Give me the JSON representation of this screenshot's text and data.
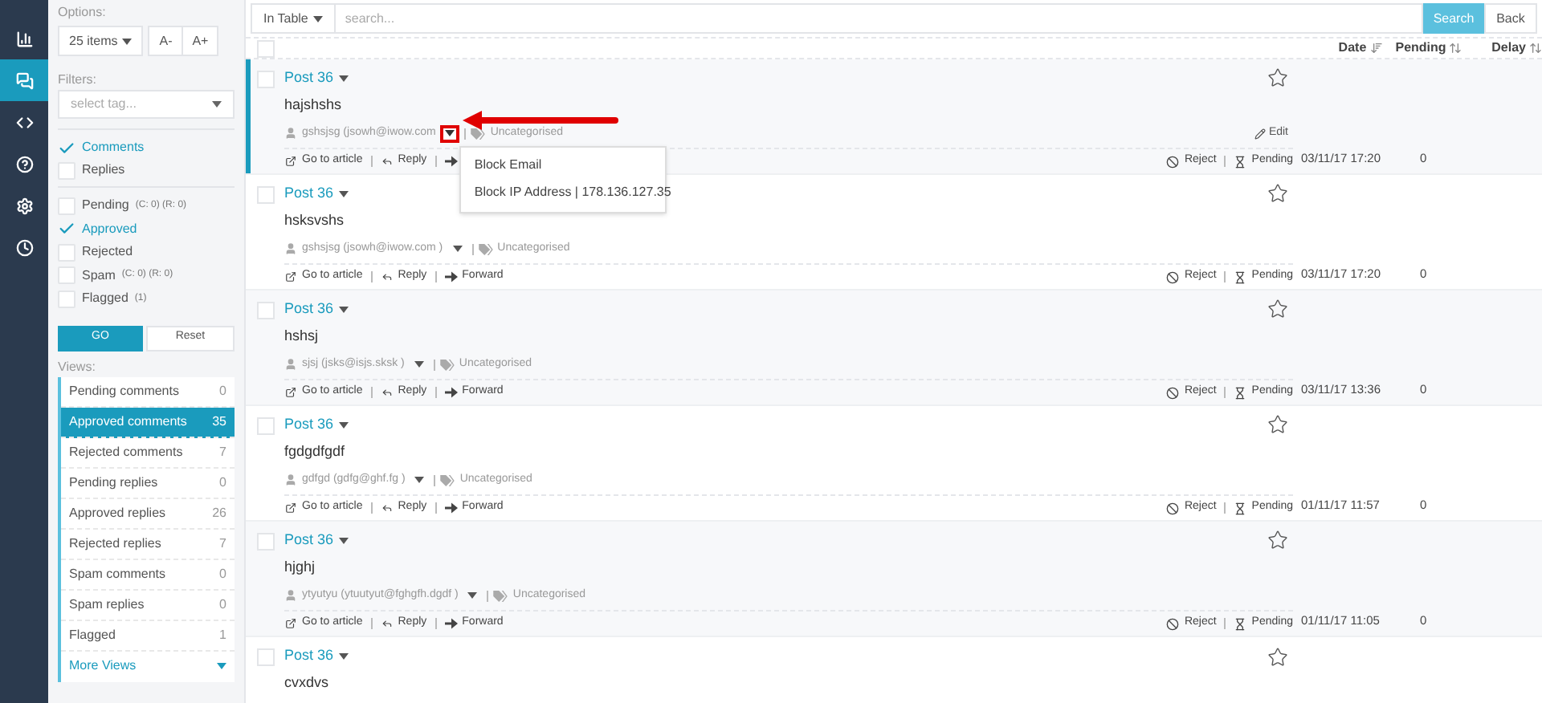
{
  "nav": [
    {
      "kind": "chart",
      "selected": false
    },
    {
      "kind": "comments",
      "selected": true
    },
    {
      "kind": "code",
      "selected": false
    },
    {
      "kind": "help",
      "selected": false
    },
    {
      "kind": "settings",
      "selected": false
    },
    {
      "kind": "history",
      "selected": false
    }
  ],
  "sidebar": {
    "options_label": "Options:",
    "page_size": "25 items",
    "font_smaller": "A-",
    "font_larger": "A+",
    "filters_label": "Filters:",
    "tag_placeholder": "select tag...",
    "types": [
      {
        "label": "Comments",
        "checked": true
      },
      {
        "label": "Replies",
        "checked": false
      }
    ],
    "statuses": [
      {
        "label": "Pending",
        "counts": "(C: 0) (R: 0)",
        "checked": false
      },
      {
        "label": "Approved",
        "checked": true
      },
      {
        "label": "Rejected",
        "checked": false
      },
      {
        "label": "Spam",
        "counts": "(C: 0) (R: 0)",
        "checked": false
      },
      {
        "label": "Flagged",
        "counts": "(1)",
        "checked": false
      }
    ],
    "go": "GO",
    "reset": "Reset",
    "views_label": "Views:",
    "views": [
      {
        "label": "Pending comments",
        "count": "0",
        "selected": false
      },
      {
        "label": "Approved comments",
        "count": "35",
        "selected": true
      },
      {
        "label": "Rejected comments",
        "count": "7",
        "selected": false
      },
      {
        "label": "Pending replies",
        "count": "0",
        "selected": false
      },
      {
        "label": "Approved replies",
        "count": "26",
        "selected": false
      },
      {
        "label": "Rejected replies",
        "count": "7",
        "selected": false
      },
      {
        "label": "Spam comments",
        "count": "0",
        "selected": false
      },
      {
        "label": "Spam replies",
        "count": "0",
        "selected": false
      },
      {
        "label": "Flagged",
        "count": "1",
        "selected": false
      }
    ],
    "more_views": "More Views"
  },
  "toolbar": {
    "scope": "In Table",
    "search_placeholder": "search...",
    "search": "Search",
    "back": "Back"
  },
  "select_all_checked": false,
  "columns": [
    "Date",
    "Pending",
    "Delay"
  ],
  "rows": [
    {
      "post": "Post 36",
      "text": "hajshshs",
      "author": "gshsjsg (jsowh@iwow.com",
      "category": "Uncategorised",
      "edit": "Edit",
      "actions": [
        {
          "kind": "article",
          "label": "Go to article"
        },
        {
          "kind": "reply",
          "label": "Reply"
        },
        {
          "kind": "forward"
        }
      ],
      "moderation": [
        "Reject",
        "Pending"
      ],
      "date": "03/11/17 17:20",
      "pending": "0",
      "selected": true,
      "checked": false,
      "starred": false,
      "menu_open": true,
      "menu": [
        "Block Email",
        "Block IP Address | 178.136.127.35"
      ]
    },
    {
      "post": "Post 36",
      "text": "hsksvshs",
      "author": "gshsjsg (jsowh@iwow.com )",
      "category": "Uncategorised",
      "actions": [
        {
          "kind": "article",
          "label": "Go to article"
        },
        {
          "kind": "reply",
          "label": "Reply"
        },
        {
          "kind": "forward",
          "label": "Forward"
        }
      ],
      "moderation": [
        "Reject",
        "Pending"
      ],
      "date": "03/11/17 17:20",
      "pending": "0",
      "selected": false,
      "checked": false,
      "starred": false,
      "menu_open": false
    },
    {
      "post": "Post 36",
      "text": "hshsj",
      "author": "sjsj (jsks@isjs.sksk )",
      "category": "Uncategorised",
      "actions": [
        {
          "kind": "article",
          "label": "Go to article"
        },
        {
          "kind": "reply",
          "label": "Reply"
        },
        {
          "kind": "forward",
          "label": "Forward"
        }
      ],
      "moderation": [
        "Reject",
        "Pending"
      ],
      "date": "03/11/17 13:36",
      "pending": "0",
      "selected": false,
      "checked": false,
      "starred": false,
      "menu_open": false
    },
    {
      "post": "Post 36",
      "text": "fgdgdfgdf",
      "author": "gdfgd (gdfg@ghf.fg )",
      "category": "Uncategorised",
      "actions": [
        {
          "kind": "article",
          "label": "Go to article"
        },
        {
          "kind": "reply",
          "label": "Reply"
        },
        {
          "kind": "forward",
          "label": "Forward"
        }
      ],
      "moderation": [
        "Reject",
        "Pending"
      ],
      "date": "01/11/17 11:57",
      "pending": "0",
      "selected": false,
      "checked": false,
      "starred": false,
      "menu_open": false
    },
    {
      "post": "Post 36",
      "text": "hjghj",
      "author": "ytyutyu (ytuutyut@fghgfh.dgdf )",
      "category": "Uncategorised",
      "actions": [
        {
          "kind": "article",
          "label": "Go to article"
        },
        {
          "kind": "reply",
          "label": "Reply"
        },
        {
          "kind": "forward",
          "label": "Forward"
        }
      ],
      "moderation": [
        "Reject",
        "Pending"
      ],
      "date": "01/11/17 11:05",
      "pending": "0",
      "selected": false,
      "checked": false,
      "starred": false,
      "menu_open": false
    },
    {
      "post": "Post 36",
      "text": "cvxdvs",
      "selected": false,
      "checked": false,
      "starred": false
    }
  ]
}
